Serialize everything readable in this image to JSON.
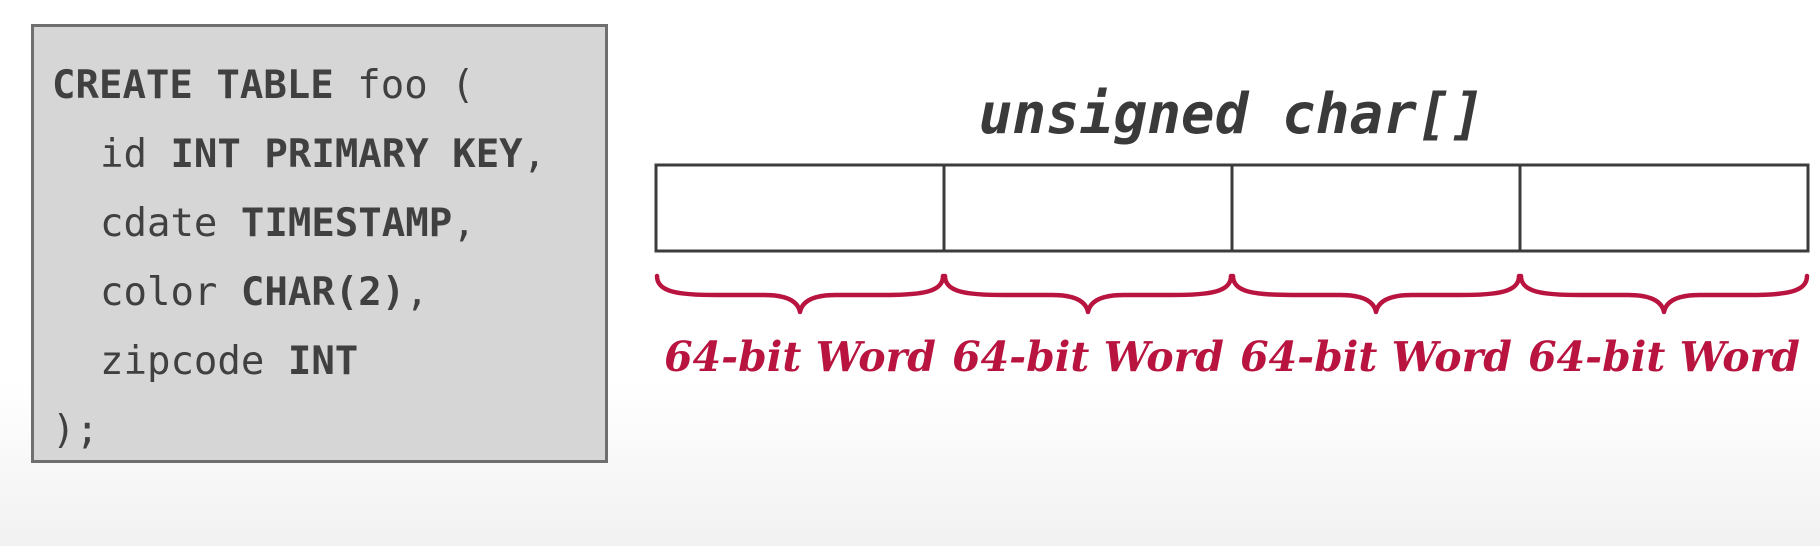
{
  "sql": {
    "lines": [
      [
        {
          "t": "CREATE TABLE",
          "kw": true
        },
        {
          "t": " foo ("
        }
      ],
      [
        {
          "t": "id "
        },
        {
          "t": "INT PRIMARY KEY",
          "kw": true
        },
        {
          "t": ","
        }
      ],
      [
        {
          "t": "cdate "
        },
        {
          "t": "TIMESTAMP",
          "kw": true
        },
        {
          "t": ","
        }
      ],
      [
        {
          "t": "color "
        },
        {
          "t": "CHAR(2)",
          "kw": true
        },
        {
          "t": ","
        }
      ],
      [
        {
          "t": "zipcode "
        },
        {
          "t": "INT",
          "kw": true
        }
      ],
      [
        {
          "t": ");"
        }
      ]
    ]
  },
  "diagram": {
    "title": "unsigned char[]",
    "words": [
      {
        "label": "64-bit Word"
      },
      {
        "label": "64-bit Word"
      },
      {
        "label": "64-bit Word"
      },
      {
        "label": "64-bit Word"
      }
    ],
    "colors": {
      "cell_border": "#3c3c3c",
      "brace": "#b8143f",
      "label": "#b8143f"
    }
  }
}
